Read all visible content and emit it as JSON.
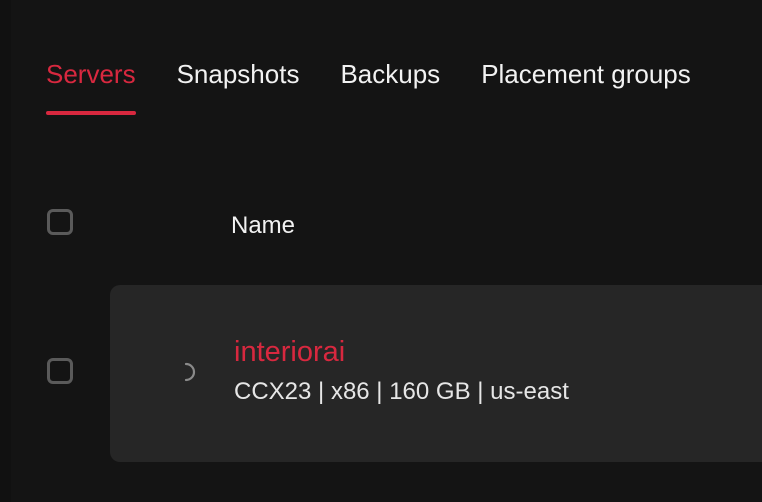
{
  "tabs": [
    {
      "label": "Servers",
      "active": true
    },
    {
      "label": "Snapshots",
      "active": false
    },
    {
      "label": "Backups",
      "active": false
    },
    {
      "label": "Placement groups",
      "active": false
    }
  ],
  "table": {
    "columns": {
      "name": "Name"
    }
  },
  "servers": [
    {
      "name": "interiorai",
      "meta": "CCX23 | x86 | 160 GB | us-east",
      "status_icon": "loading-spinner-icon"
    }
  ],
  "colors": {
    "accent": "#d8283f",
    "background": "#141414",
    "row_background": "#262626"
  }
}
